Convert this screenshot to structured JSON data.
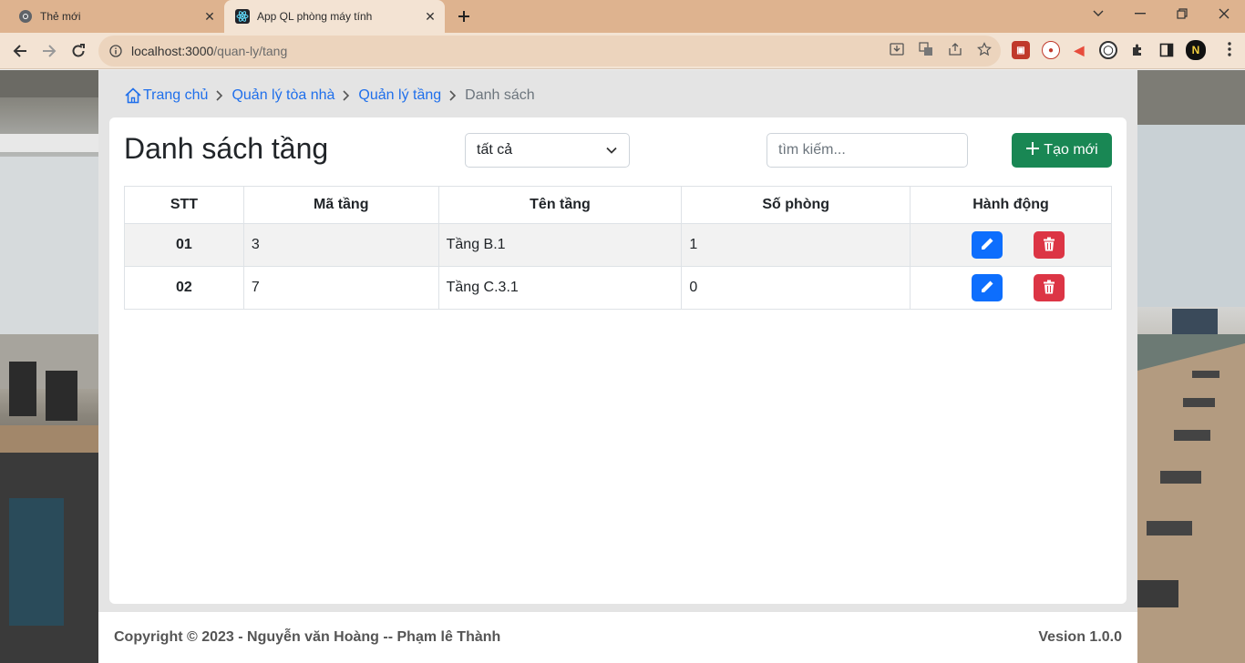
{
  "browser": {
    "tabs": [
      {
        "title": "Thẻ mới",
        "active": false
      },
      {
        "title": "App QL phòng máy tính",
        "active": true
      }
    ],
    "address": {
      "host": "localhost:3000",
      "path": "/quan-ly/tang"
    }
  },
  "breadcrumb": {
    "home": "Trang chủ",
    "building": "Quản lý tòa nhà",
    "floor": "Quản lý tầng",
    "current": "Danh sách"
  },
  "page": {
    "title": "Danh sách tầng",
    "filter_value": "tất cả",
    "search_placeholder": "tìm kiếm...",
    "create_label": "Tạo mới"
  },
  "table": {
    "headers": [
      "STT",
      "Mã tầng",
      "Tên tầng",
      "Số phòng",
      "Hành động"
    ],
    "rows": [
      {
        "stt": "01",
        "code": "3",
        "name": "Tầng B.1",
        "rooms": "1"
      },
      {
        "stt": "02",
        "code": "7",
        "name": "Tầng C.3.1",
        "rooms": "0"
      }
    ]
  },
  "footer": {
    "copyright": "Copyright © 2023 - Nguyễn văn Hoàng -- Phạm lê Thành",
    "version": "Vesion 1.0.0"
  },
  "colors": {
    "primary": "#0d6efd",
    "success": "#198754",
    "danger": "#dc3545",
    "link": "#1f6feb"
  }
}
